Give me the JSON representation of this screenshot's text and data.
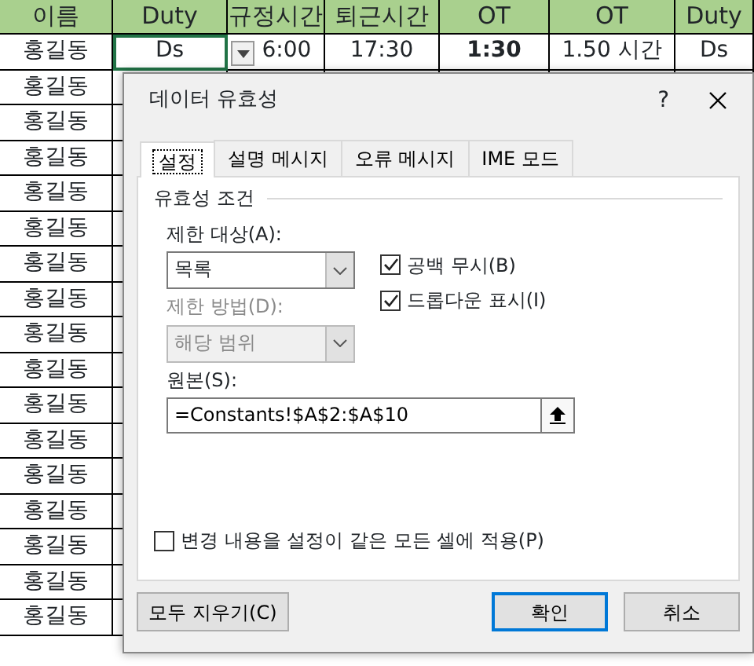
{
  "sheet": {
    "columns": [
      "이름",
      "Duty",
      "규정시간",
      "퇴근시간",
      "OT",
      "OT",
      "Duty"
    ],
    "rows": [
      {
        "cells": [
          "홍길동",
          {
            "text": "Ds",
            "selected": true
          },
          "6:00",
          "17:30",
          {
            "text": "1:30",
            "bold": true
          },
          "1.50 시간",
          "Ds"
        ]
      },
      {
        "cells": [
          "홍길동"
        ]
      },
      {
        "cells": [
          "홍길동"
        ]
      },
      {
        "cells": [
          "홍길동"
        ]
      },
      {
        "cells": [
          "홍길동"
        ]
      },
      {
        "cells": [
          "홍길동"
        ]
      },
      {
        "cells": [
          "홍길동"
        ]
      },
      {
        "cells": [
          "홍길동"
        ]
      },
      {
        "cells": [
          "홍길동"
        ]
      },
      {
        "cells": [
          "홍길동"
        ]
      },
      {
        "cells": [
          "홍길동"
        ]
      },
      {
        "cells": [
          "홍길동"
        ]
      },
      {
        "cells": [
          "홍길동"
        ]
      },
      {
        "cells": [
          "홍길동"
        ]
      },
      {
        "cells": [
          "홍길동"
        ]
      },
      {
        "cells": [
          "홍길동"
        ]
      },
      {
        "cells": [
          "홍길동"
        ]
      }
    ]
  },
  "dialog": {
    "title": "데이터 유효성",
    "help": "?",
    "tabs": [
      {
        "label": "설정",
        "selected": true
      },
      {
        "label": "설명 메시지",
        "selected": false
      },
      {
        "label": "오류 메시지",
        "selected": false
      },
      {
        "label": "IME 모드",
        "selected": false
      }
    ],
    "group_title": "유효성 조건",
    "allow": {
      "label": "제한 대상(A):",
      "value": "목록",
      "disabled": false
    },
    "data": {
      "label": "제한 방법(D):",
      "value": "해당 범위",
      "disabled": true
    },
    "checkboxes": [
      {
        "label": "공백 무시(B)",
        "checked": true
      },
      {
        "label": "드롭다운 표시(I)",
        "checked": true
      }
    ],
    "source": {
      "label": "원본(S):",
      "value": "=Constants!$A$2:$A$10"
    },
    "apply_all": {
      "label": "변경 내용을 설정이 같은 모든 셀에 적용(P)",
      "checked": false
    },
    "buttons": [
      {
        "label": "모두 지우기(C)",
        "default": false
      },
      {
        "label": "확인",
        "default": true
      },
      {
        "label": "취소",
        "default": false
      }
    ]
  }
}
